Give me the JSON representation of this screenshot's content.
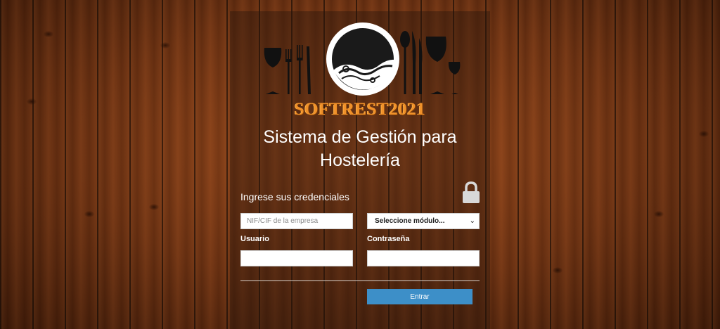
{
  "brand": {
    "name": "SOFTREST2021",
    "subtitle_line1": "Sistema de Gestión para",
    "subtitle_line2": "Hostelería"
  },
  "form": {
    "credentials_label": "Ingrese sus credenciales",
    "nif_placeholder": "NIF/CIF de la empresa",
    "module_select_value": "Seleccione módulo...",
    "user_label": "Usuario",
    "password_label": "Contraseña",
    "user_value": "",
    "password_value": "",
    "submit_label": "Entrar"
  },
  "icons": {
    "lock": "lock-icon",
    "logo": "restaurant-logo",
    "select_chevron": "chevron-down-icon"
  },
  "colors": {
    "brand_orange": "#f0912a",
    "button_blue": "#3d8fc8",
    "text_white": "#ffffff"
  }
}
